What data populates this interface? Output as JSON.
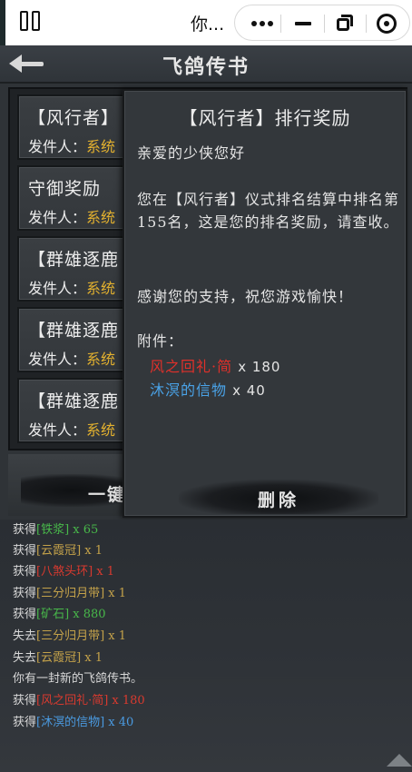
{
  "topbar": {
    "title": "你...",
    "icons": [
      "window-icon",
      "more-icon",
      "minimize-icon",
      "restore-icon",
      "close-target-icon"
    ]
  },
  "header": {
    "title": "飞鸽传书",
    "back_icon": "back-arrow-icon"
  },
  "mail_list": [
    {
      "subject": "【风行者】",
      "sender_label": "发件人：",
      "sender": "系统"
    },
    {
      "subject": "守御奖励",
      "sender_label": "发件人：",
      "sender": "系统"
    },
    {
      "subject": "【群雄逐鹿",
      "sender_label": "发件人：",
      "sender": "系统"
    },
    {
      "subject": "【群雄逐鹿",
      "sender_label": "发件人：",
      "sender": "系统"
    },
    {
      "subject": "【群雄逐鹿",
      "sender_label": "发件人：",
      "sender": "系统"
    }
  ],
  "onekey_label": "一键",
  "detail": {
    "title": "【风行者】排行奖励",
    "greeting": "亲爱的少侠您好",
    "body": "您在【风行者】仪式排名结算中排名第155名，这是您的排名奖励，请查收。",
    "thanks": "感谢您的支持，祝您游戏愉快！",
    "attach_label": "附件：",
    "attachments": [
      {
        "name": "风之回礼·简",
        "qty": "x 180",
        "color": "#e0302a"
      },
      {
        "name": "沐溟的信物",
        "qty": "x 40",
        "color": "#4aa3e8"
      }
    ],
    "delete_label": "删除"
  },
  "log": [
    {
      "prefix": "获得",
      "item": "[铁浆]",
      "qty": " x 65",
      "color": "#48b84a"
    },
    {
      "prefix": "获得",
      "item": "[云霞冠]",
      "qty": " x 1",
      "color": "#c4a24a"
    },
    {
      "prefix": "获得",
      "item": "[八煞头环]",
      "qty": " x 1",
      "color": "#d83a2f"
    },
    {
      "prefix": "获得",
      "item": "[三分归月带]",
      "qty": " x 1",
      "color": "#c4a24a"
    },
    {
      "prefix": "获得",
      "item": "[矿石]",
      "qty": " x 880",
      "color": "#48b84a"
    },
    {
      "prefix": "失去",
      "item": "[三分归月带]",
      "qty": " x 1",
      "color": "#c4a24a"
    },
    {
      "prefix": "失去",
      "item": "[云霞冠]",
      "qty": " x 1",
      "color": "#c4a24a"
    },
    {
      "prefix": "你有一封新的飞鸽传书。",
      "item": "",
      "qty": "",
      "color": "#d8d8d8"
    },
    {
      "prefix": "获得",
      "item": "[风之回礼·简]",
      "qty": " x 180",
      "color": "#d83a2f"
    },
    {
      "prefix": "获得",
      "item": "[沐溟的信物]",
      "qty": " x 40",
      "color": "#4a9ae0"
    }
  ]
}
